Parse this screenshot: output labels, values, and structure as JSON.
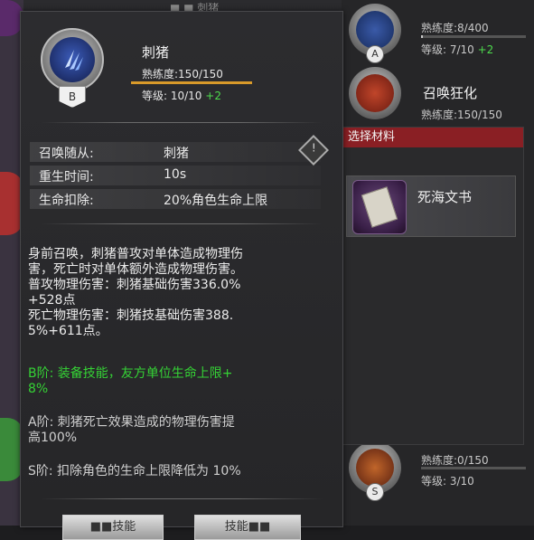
{
  "background": {
    "top_text": "■ ■ 刺猪",
    "skills": [
      {
        "letter": "A",
        "name": "",
        "prof": "熟练度:8/400",
        "level": "等级: 7/10 ",
        "plus": "+2",
        "prof_fraction": 0.02
      },
      {
        "letter": "",
        "name": "召唤狂化",
        "prof": "熟练度:150/150",
        "level": "",
        "plus": "",
        "prof_fraction": 1.0
      },
      {
        "letter": "S",
        "name": "",
        "prof": "熟练度:0/150",
        "level": "等级: 3/10",
        "plus": "",
        "prof_fraction": 0.0
      }
    ]
  },
  "materials": {
    "header": "选择材料",
    "items": [
      {
        "name": "死海文书",
        "icon": "book-icon"
      }
    ]
  },
  "card": {
    "medal_letter": "B",
    "icon": "claw-icon",
    "title": "刺猪",
    "prof": "熟练度:150/150",
    "prof_fraction": 1.0,
    "level": "等级: 10/10 ",
    "level_plus": "+2",
    "attrs": [
      {
        "label": "召唤随从:",
        "value": "刺猪"
      },
      {
        "label": "重生时间:",
        "value": "10s"
      },
      {
        "label": "生命扣除:",
        "value": "20%角色生命上限"
      }
    ],
    "warn_icon": "warning-icon",
    "desc": [
      "身前召唤，刺猪普攻对单体造成物理伤",
      "害，死亡时对单体额外造成物理伤害。",
      "普攻物理伤害：刺猪基础伤害336.0%",
      "+528点",
      "死亡物理伤害：刺猪技基础伤害388.",
      "5%+611点。"
    ],
    "tier_b": [
      "B阶: 装备技能，友方单位生命上限+",
      "8%"
    ],
    "tier_a": [
      "A阶: 刺猪死亡效果造成的物理伤害提",
      "高100%"
    ],
    "tier_s": [
      "S阶: 扣除角色的生命上限降低为 10%"
    ],
    "buttons": [
      "■■技能",
      "技能■■"
    ]
  },
  "colors": {
    "accent_red": "#8a1f24",
    "gold": "#d99a2a",
    "green": "#35d235"
  }
}
